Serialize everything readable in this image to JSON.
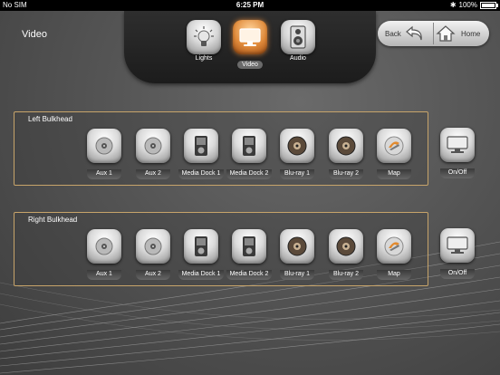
{
  "status": {
    "carrier": "No SIM",
    "time": "6:25 PM",
    "battery": "100%"
  },
  "page_title": "Video",
  "tabs": [
    {
      "label": "Lights",
      "icon": "light-bulb-icon",
      "active": false
    },
    {
      "label": "Video",
      "icon": "monitor-icon",
      "active": true
    },
    {
      "label": "Audio",
      "icon": "speaker-icon",
      "active": false
    }
  ],
  "nav": {
    "back": "Back",
    "home": "Home"
  },
  "groups": [
    {
      "title": "Left Bulkhead",
      "sources": [
        "Aux 1",
        "Aux 2",
        "Media Dock 1",
        "Media Dock 2",
        "Blu-ray 1",
        "Blu-ray 2",
        "Map"
      ],
      "power": "On/Off"
    },
    {
      "title": "Right Bulkhead",
      "sources": [
        "Aux 1",
        "Aux 2",
        "Media Dock 1",
        "Media Dock 2",
        "Blu-ray 1",
        "Blu-ray 2",
        "Map"
      ],
      "power": "On/Off"
    }
  ],
  "colors": {
    "accent": "#e08a3a",
    "group_border": "#c7a46a"
  }
}
